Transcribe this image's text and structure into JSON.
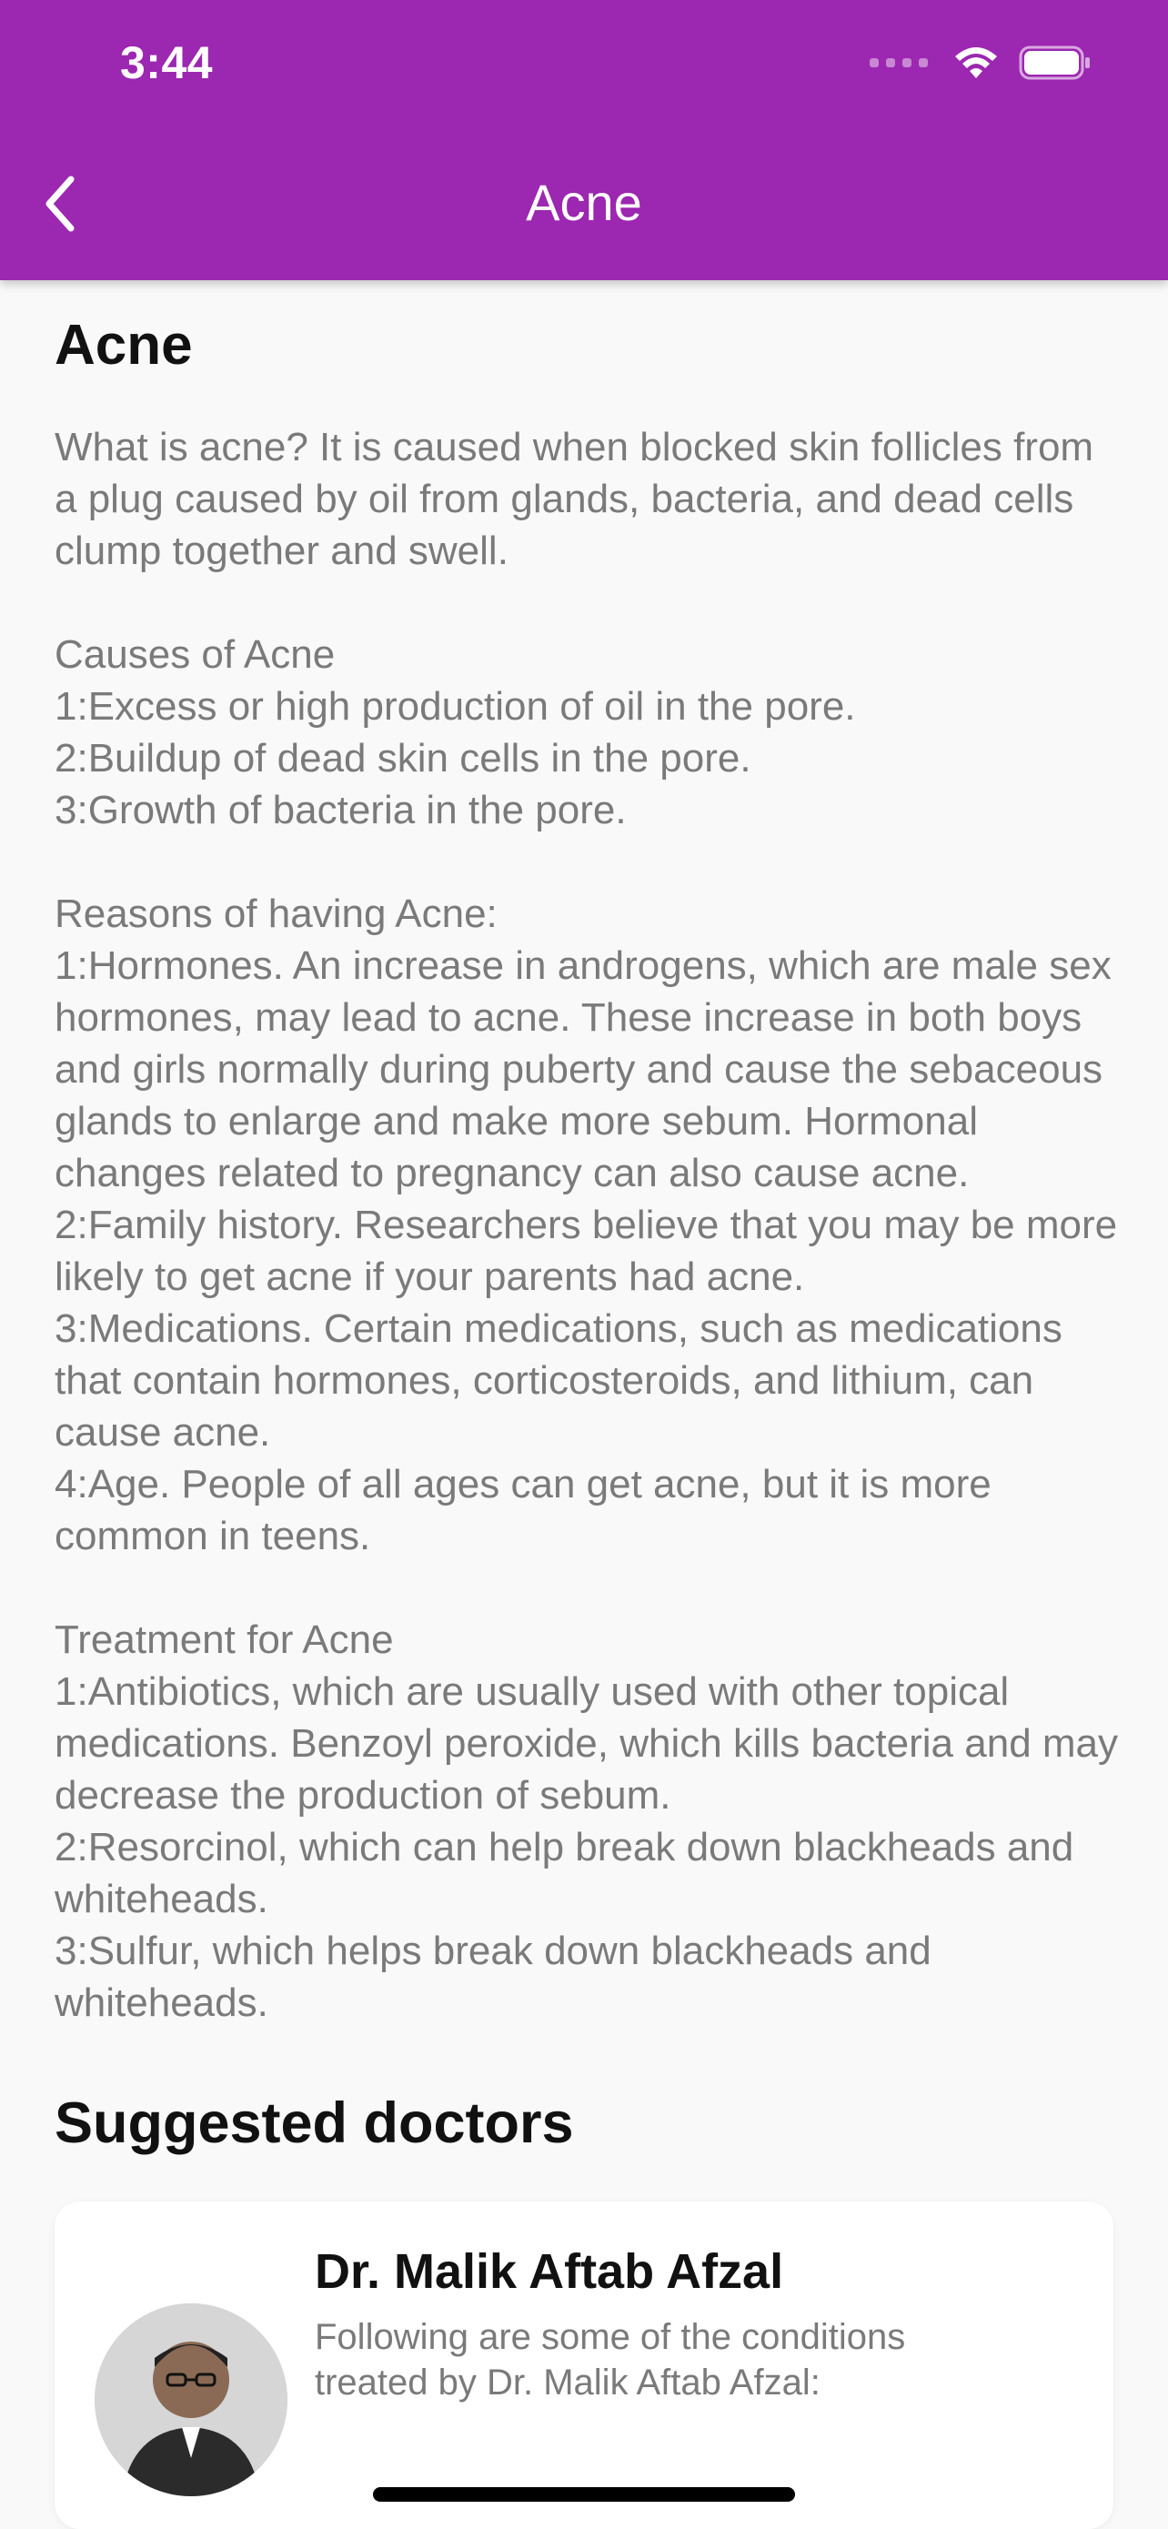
{
  "status_bar": {
    "time": "3:44"
  },
  "nav": {
    "title": "Acne",
    "back_icon": "chevron-left-icon"
  },
  "article": {
    "title": "Acne",
    "body": "What is acne? It is caused when blocked skin follicles from a plug caused by oil from glands, bacteria, and dead cells clump together and swell.\n\nCauses of Acne\n1:Excess or high production of oil in the pore.\n2:Buildup of dead skin cells in the pore.\n3:Growth of bacteria in the pore.\n\nReasons of having Acne:\n1:Hormones. An increase in androgens, which are male sex hormones, may lead to acne. These increase in both boys and girls normally during puberty and cause the sebaceous glands to enlarge and make more sebum. Hormonal changes related to pregnancy can also cause acne.\n2:Family history. Researchers believe that you may be more likely to get acne if your parents had acne.\n3:Medications. Certain medications, such as medications that contain hormones, corticosteroids, and lithium, can cause acne.\n4:Age. People of all ages can get acne, but it is more common in teens.\n\nTreatment for Acne\n1:Antibiotics, which are usually used with other topical medications. Benzoyl peroxide, which kills bacteria and may decrease the production of sebum.\n2:Resorcinol, which can help break down blackheads and whiteheads.\n3:Sulfur, which helps break down blackheads and whiteheads."
  },
  "suggested": {
    "title": "Suggested doctors",
    "doctors": [
      {
        "name": "Dr. Malik Aftab Afzal",
        "description": "Following are some of the conditions treated by Dr. Malik Aftab Afzal:"
      }
    ]
  },
  "colors": {
    "header": "#9c27b0",
    "background": "#f9f9f9",
    "body_text": "#7a7a7a",
    "heading_text": "#111111"
  }
}
